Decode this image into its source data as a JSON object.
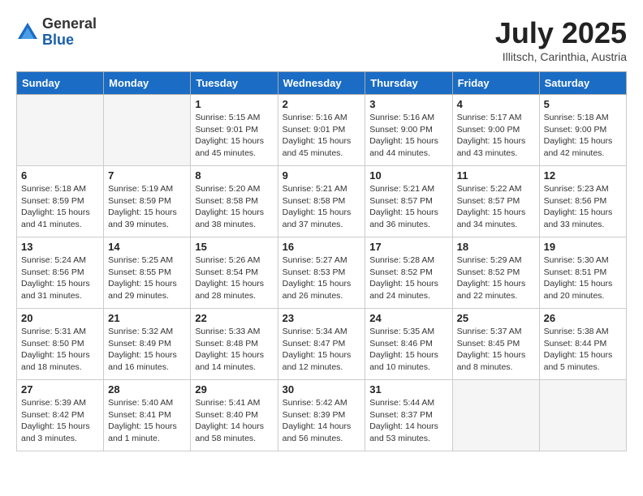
{
  "logo": {
    "general": "General",
    "blue": "Blue"
  },
  "title": "July 2025",
  "location": "Illitsch, Carinthia, Austria",
  "days_of_week": [
    "Sunday",
    "Monday",
    "Tuesday",
    "Wednesday",
    "Thursday",
    "Friday",
    "Saturday"
  ],
  "weeks": [
    [
      {
        "day": null,
        "sunrise": null,
        "sunset": null,
        "daylight": null
      },
      {
        "day": null,
        "sunrise": null,
        "sunset": null,
        "daylight": null
      },
      {
        "day": "1",
        "sunrise": "Sunrise: 5:15 AM",
        "sunset": "Sunset: 9:01 PM",
        "daylight": "Daylight: 15 hours and 45 minutes."
      },
      {
        "day": "2",
        "sunrise": "Sunrise: 5:16 AM",
        "sunset": "Sunset: 9:01 PM",
        "daylight": "Daylight: 15 hours and 45 minutes."
      },
      {
        "day": "3",
        "sunrise": "Sunrise: 5:16 AM",
        "sunset": "Sunset: 9:00 PM",
        "daylight": "Daylight: 15 hours and 44 minutes."
      },
      {
        "day": "4",
        "sunrise": "Sunrise: 5:17 AM",
        "sunset": "Sunset: 9:00 PM",
        "daylight": "Daylight: 15 hours and 43 minutes."
      },
      {
        "day": "5",
        "sunrise": "Sunrise: 5:18 AM",
        "sunset": "Sunset: 9:00 PM",
        "daylight": "Daylight: 15 hours and 42 minutes."
      }
    ],
    [
      {
        "day": "6",
        "sunrise": "Sunrise: 5:18 AM",
        "sunset": "Sunset: 8:59 PM",
        "daylight": "Daylight: 15 hours and 41 minutes."
      },
      {
        "day": "7",
        "sunrise": "Sunrise: 5:19 AM",
        "sunset": "Sunset: 8:59 PM",
        "daylight": "Daylight: 15 hours and 39 minutes."
      },
      {
        "day": "8",
        "sunrise": "Sunrise: 5:20 AM",
        "sunset": "Sunset: 8:58 PM",
        "daylight": "Daylight: 15 hours and 38 minutes."
      },
      {
        "day": "9",
        "sunrise": "Sunrise: 5:21 AM",
        "sunset": "Sunset: 8:58 PM",
        "daylight": "Daylight: 15 hours and 37 minutes."
      },
      {
        "day": "10",
        "sunrise": "Sunrise: 5:21 AM",
        "sunset": "Sunset: 8:57 PM",
        "daylight": "Daylight: 15 hours and 36 minutes."
      },
      {
        "day": "11",
        "sunrise": "Sunrise: 5:22 AM",
        "sunset": "Sunset: 8:57 PM",
        "daylight": "Daylight: 15 hours and 34 minutes."
      },
      {
        "day": "12",
        "sunrise": "Sunrise: 5:23 AM",
        "sunset": "Sunset: 8:56 PM",
        "daylight": "Daylight: 15 hours and 33 minutes."
      }
    ],
    [
      {
        "day": "13",
        "sunrise": "Sunrise: 5:24 AM",
        "sunset": "Sunset: 8:56 PM",
        "daylight": "Daylight: 15 hours and 31 minutes."
      },
      {
        "day": "14",
        "sunrise": "Sunrise: 5:25 AM",
        "sunset": "Sunset: 8:55 PM",
        "daylight": "Daylight: 15 hours and 29 minutes."
      },
      {
        "day": "15",
        "sunrise": "Sunrise: 5:26 AM",
        "sunset": "Sunset: 8:54 PM",
        "daylight": "Daylight: 15 hours and 28 minutes."
      },
      {
        "day": "16",
        "sunrise": "Sunrise: 5:27 AM",
        "sunset": "Sunset: 8:53 PM",
        "daylight": "Daylight: 15 hours and 26 minutes."
      },
      {
        "day": "17",
        "sunrise": "Sunrise: 5:28 AM",
        "sunset": "Sunset: 8:52 PM",
        "daylight": "Daylight: 15 hours and 24 minutes."
      },
      {
        "day": "18",
        "sunrise": "Sunrise: 5:29 AM",
        "sunset": "Sunset: 8:52 PM",
        "daylight": "Daylight: 15 hours and 22 minutes."
      },
      {
        "day": "19",
        "sunrise": "Sunrise: 5:30 AM",
        "sunset": "Sunset: 8:51 PM",
        "daylight": "Daylight: 15 hours and 20 minutes."
      }
    ],
    [
      {
        "day": "20",
        "sunrise": "Sunrise: 5:31 AM",
        "sunset": "Sunset: 8:50 PM",
        "daylight": "Daylight: 15 hours and 18 minutes."
      },
      {
        "day": "21",
        "sunrise": "Sunrise: 5:32 AM",
        "sunset": "Sunset: 8:49 PM",
        "daylight": "Daylight: 15 hours and 16 minutes."
      },
      {
        "day": "22",
        "sunrise": "Sunrise: 5:33 AM",
        "sunset": "Sunset: 8:48 PM",
        "daylight": "Daylight: 15 hours and 14 minutes."
      },
      {
        "day": "23",
        "sunrise": "Sunrise: 5:34 AM",
        "sunset": "Sunset: 8:47 PM",
        "daylight": "Daylight: 15 hours and 12 minutes."
      },
      {
        "day": "24",
        "sunrise": "Sunrise: 5:35 AM",
        "sunset": "Sunset: 8:46 PM",
        "daylight": "Daylight: 15 hours and 10 minutes."
      },
      {
        "day": "25",
        "sunrise": "Sunrise: 5:37 AM",
        "sunset": "Sunset: 8:45 PM",
        "daylight": "Daylight: 15 hours and 8 minutes."
      },
      {
        "day": "26",
        "sunrise": "Sunrise: 5:38 AM",
        "sunset": "Sunset: 8:44 PM",
        "daylight": "Daylight: 15 hours and 5 minutes."
      }
    ],
    [
      {
        "day": "27",
        "sunrise": "Sunrise: 5:39 AM",
        "sunset": "Sunset: 8:42 PM",
        "daylight": "Daylight: 15 hours and 3 minutes."
      },
      {
        "day": "28",
        "sunrise": "Sunrise: 5:40 AM",
        "sunset": "Sunset: 8:41 PM",
        "daylight": "Daylight: 15 hours and 1 minute."
      },
      {
        "day": "29",
        "sunrise": "Sunrise: 5:41 AM",
        "sunset": "Sunset: 8:40 PM",
        "daylight": "Daylight: 14 hours and 58 minutes."
      },
      {
        "day": "30",
        "sunrise": "Sunrise: 5:42 AM",
        "sunset": "Sunset: 8:39 PM",
        "daylight": "Daylight: 14 hours and 56 minutes."
      },
      {
        "day": "31",
        "sunrise": "Sunrise: 5:44 AM",
        "sunset": "Sunset: 8:37 PM",
        "daylight": "Daylight: 14 hours and 53 minutes."
      },
      {
        "day": null,
        "sunrise": null,
        "sunset": null,
        "daylight": null
      },
      {
        "day": null,
        "sunrise": null,
        "sunset": null,
        "daylight": null
      }
    ]
  ]
}
